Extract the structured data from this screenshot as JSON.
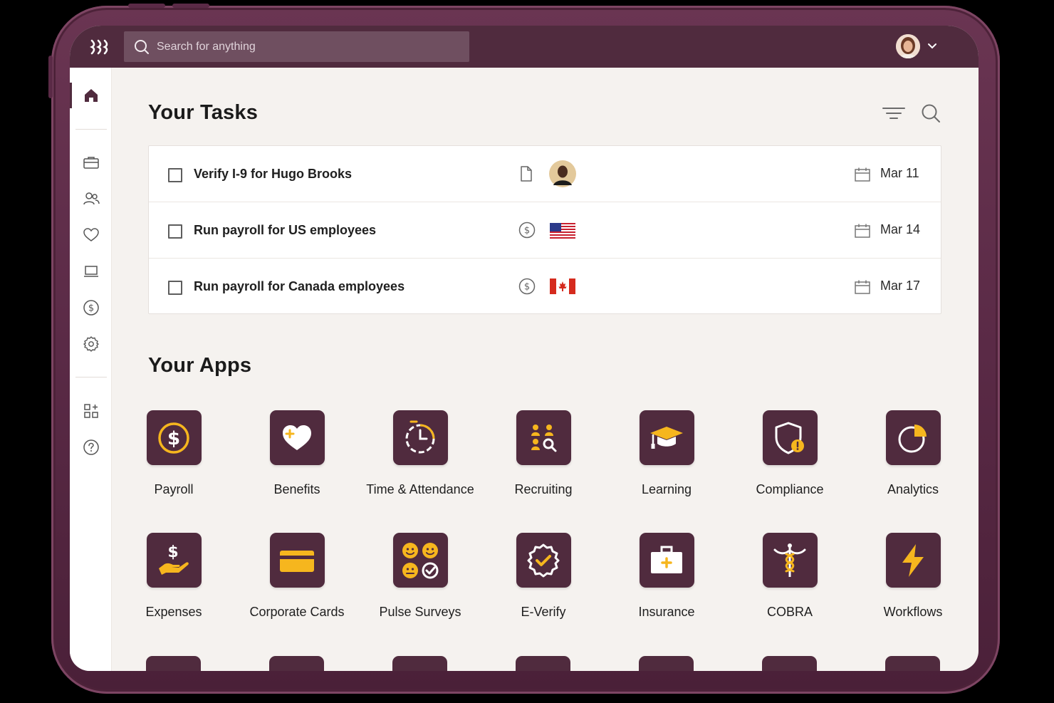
{
  "header": {
    "search_placeholder": "Search for anything"
  },
  "tasks": {
    "title": "Your Tasks",
    "items": [
      {
        "label": "Verify I-9 for Hugo Brooks",
        "date": "Mar 11"
      },
      {
        "label": "Run payroll for US employees",
        "date": "Mar 14"
      },
      {
        "label": "Run payroll for Canada employees",
        "date": "Mar 17"
      }
    ]
  },
  "apps": {
    "title": "Your Apps",
    "row1": [
      {
        "name": "Payroll"
      },
      {
        "name": "Benefits"
      },
      {
        "name": "Time & Attendance"
      },
      {
        "name": "Recruiting"
      },
      {
        "name": "Learning"
      },
      {
        "name": "Compliance"
      },
      {
        "name": "Analytics"
      }
    ],
    "row2": [
      {
        "name": "Expenses"
      },
      {
        "name": "Corporate Cards"
      },
      {
        "name": "Pulse Surveys"
      },
      {
        "name": "E-Verify"
      },
      {
        "name": "Insurance"
      },
      {
        "name": "COBRA"
      },
      {
        "name": "Workflows"
      }
    ]
  },
  "colors": {
    "brand": "#502b3e",
    "accent": "#f6b61e",
    "background": "#f5f2ef"
  }
}
